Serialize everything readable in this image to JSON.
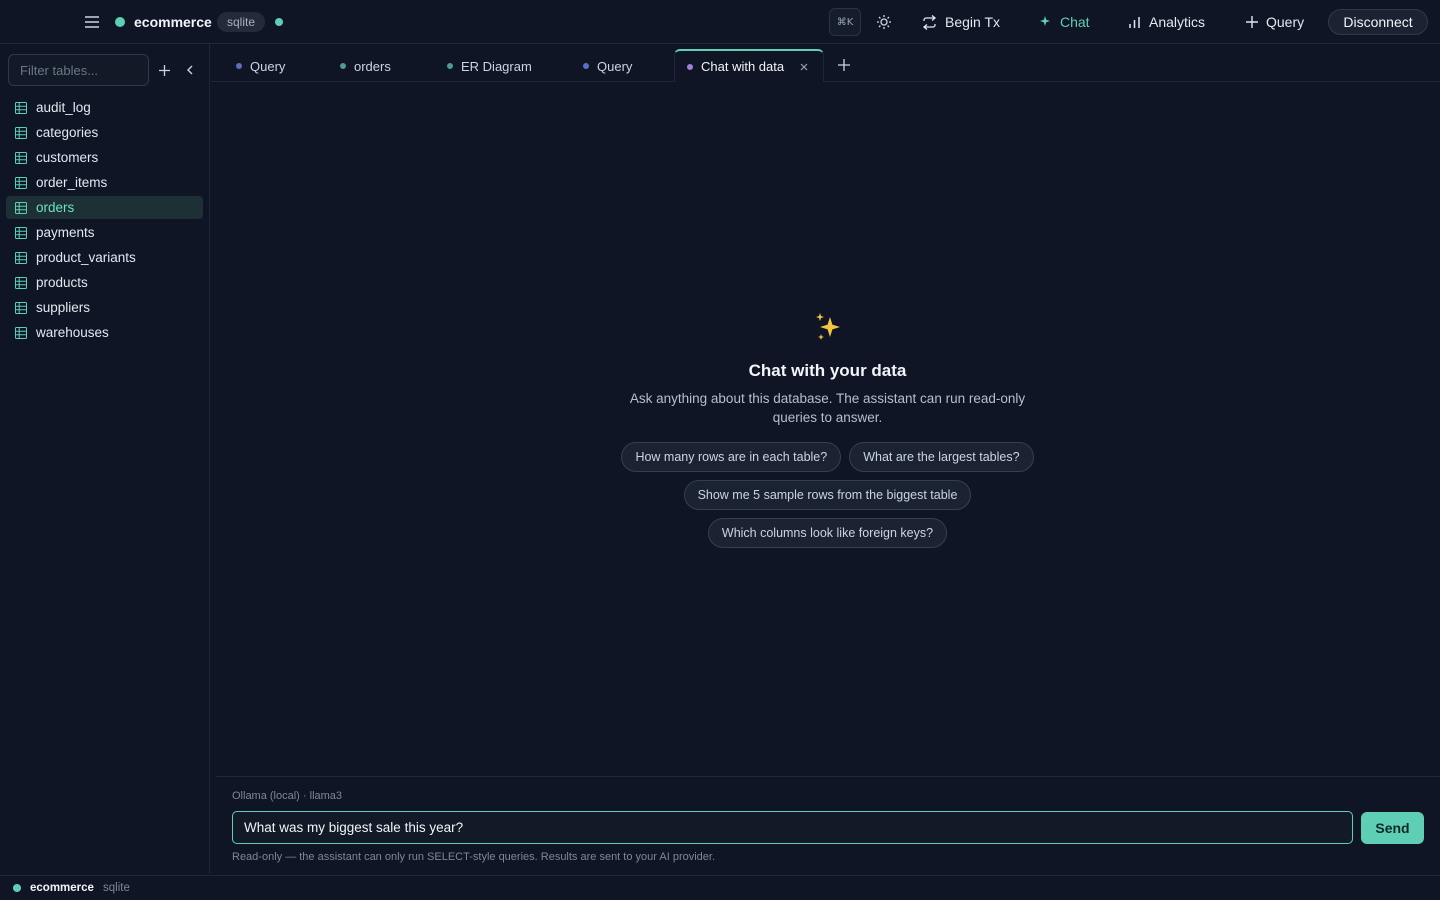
{
  "topbar": {
    "connection_name": "ecommerce",
    "connection_engine": "sqlite",
    "shortcut_hint": "⌘K",
    "buttons": {
      "begin_tx": "Begin Tx",
      "chat": "Chat",
      "analytics": "Analytics",
      "query": "Query",
      "disconnect": "Disconnect"
    },
    "active_button": "chat"
  },
  "sidebar": {
    "filter_placeholder": "Filter tables...",
    "filter_value": "",
    "tables": [
      {
        "name": "audit_log",
        "selected": false
      },
      {
        "name": "categories",
        "selected": false
      },
      {
        "name": "customers",
        "selected": false
      },
      {
        "name": "order_items",
        "selected": false
      },
      {
        "name": "orders",
        "selected": true
      },
      {
        "name": "payments",
        "selected": false
      },
      {
        "name": "product_variants",
        "selected": false
      },
      {
        "name": "products",
        "selected": false
      },
      {
        "name": "suppliers",
        "selected": false
      },
      {
        "name": "warehouses",
        "selected": false
      }
    ]
  },
  "tabs": [
    {
      "label": "Query",
      "dot_color": "#5b6fc2",
      "active": false
    },
    {
      "label": "orders",
      "dot_color": "#4e9c8b",
      "active": false
    },
    {
      "label": "ER Diagram",
      "dot_color": "#4e9c8b",
      "active": false
    },
    {
      "label": "Query",
      "dot_color": "#5b6fc2",
      "active": false
    },
    {
      "label": "Chat with data",
      "dot_color": "#a47ed6",
      "active": true
    }
  ],
  "chat": {
    "empty_icon": "sparkles-icon",
    "title": "Chat with your data",
    "description": "Ask anything about this database. The assistant can run read-only queries to answer.",
    "suggestions": [
      "How many rows are in each table?",
      "What are the largest tables?",
      "Show me 5 sample rows from the biggest table",
      "Which columns look like foreign keys?"
    ],
    "provider": "Ollama (local) · llama3",
    "input_value": "What was my biggest sale this year?",
    "send_label": "Send",
    "disclaimer": "Read-only — the assistant can only run SELECT-style queries. Results are sent to your AI provider."
  },
  "statusbar": {
    "connection_name": "ecommerce",
    "connection_engine": "sqlite"
  },
  "colors": {
    "accent": "#5ecfb5",
    "background": "#0f1524",
    "border": "#1f2737"
  }
}
